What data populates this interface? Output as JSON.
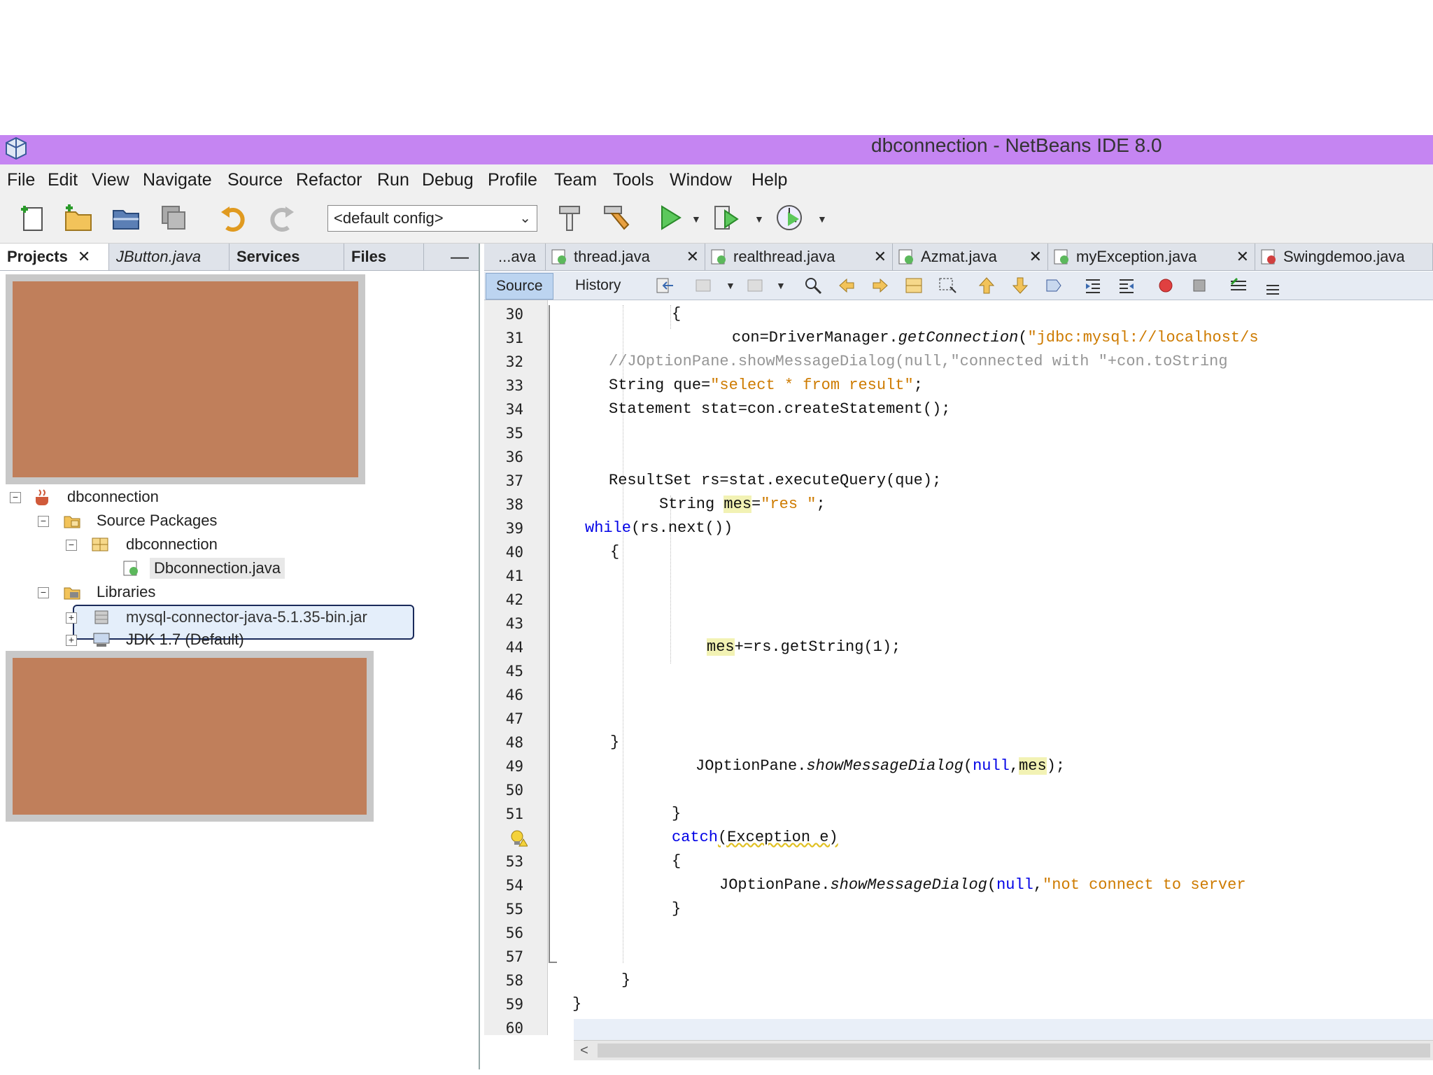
{
  "window": {
    "title": "dbconnection - NetBeans IDE 8.0"
  },
  "menu": [
    "File",
    "Edit",
    "View",
    "Navigate",
    "Source",
    "Refactor",
    "Run",
    "Debug",
    "Profile",
    "Team",
    "Tools",
    "Window",
    "Help"
  ],
  "toolbar": {
    "config_value": "<default config>"
  },
  "left_tabs": [
    "Projects",
    "JButton.java",
    "Services",
    "Files"
  ],
  "tree": {
    "project": "dbconnection",
    "source_packages": "Source Packages",
    "package": "dbconnection",
    "file": "Dbconnection.java",
    "libraries": "Libraries",
    "jar": "mysql-connector-java-5.1.35-bin.jar",
    "jdk": "JDK 1.7 (Default)"
  },
  "editor_tabs": [
    "...ava",
    "thread.java",
    "realthread.java",
    "Azmat.java",
    "myException.java",
    "Swingdemoo.java"
  ],
  "editor_toolbar": {
    "source": "Source",
    "history": "History"
  },
  "line_numbers": [
    "30",
    "31",
    "32",
    "33",
    "34",
    "35",
    "36",
    "37",
    "38",
    "39",
    "40",
    "41",
    "42",
    "43",
    "44",
    "45",
    "46",
    "47",
    "48",
    "49",
    "50",
    "51",
    "",
    "53",
    "54",
    "55",
    "56",
    "57",
    "58",
    "59",
    "60"
  ],
  "code": {
    "l30": "{",
    "l31_a": "con=DriverManager.",
    "l31_b": "getConnection",
    "l31_c": "(",
    "l31_d": "\"jdbc:mysql://localhost/s",
    "l32": "//JOptionPane.showMessageDialog(null,\"connected with \"+con.toString",
    "l33_a": "String que=",
    "l33_b": "\"select * from result\"",
    "l33_c": ";",
    "l34": "Statement stat=con.createStatement();",
    "l37": "ResultSet rs=stat.executeQuery(que);",
    "l38_a": "String ",
    "l38_b": "mes",
    "l38_c": "=",
    "l38_d": "\"res \"",
    "l38_e": ";",
    "l39_a": "while",
    "l39_b": "(rs.next())",
    "l40": "{",
    "l44_a": "mes",
    "l44_b": "+=rs.getString(1);",
    "l48": "}",
    "l49_a": "JOptionPane.",
    "l49_b": "showMessageDialog",
    "l49_c": "(",
    "l49_d": "null",
    "l49_e": ",",
    "l49_f": "mes",
    "l49_g": ");",
    "l51": "}",
    "l52_a": "catch",
    "l52_b": "(Exception e)",
    "l53": "{",
    "l54_a": "JOptionPane.",
    "l54_b": "showMessageDialog",
    "l54_c": "(",
    "l54_d": "null",
    "l54_e": ",",
    "l54_f": "\"not connect to server ",
    "l55": "}",
    "l57": "}",
    "l59": "}"
  },
  "colors": {
    "titlebar": "#c585f2",
    "keyword": "#0000e6",
    "string": "#ce7b00",
    "comment": "#969696",
    "redaction": "#c07f5b"
  }
}
